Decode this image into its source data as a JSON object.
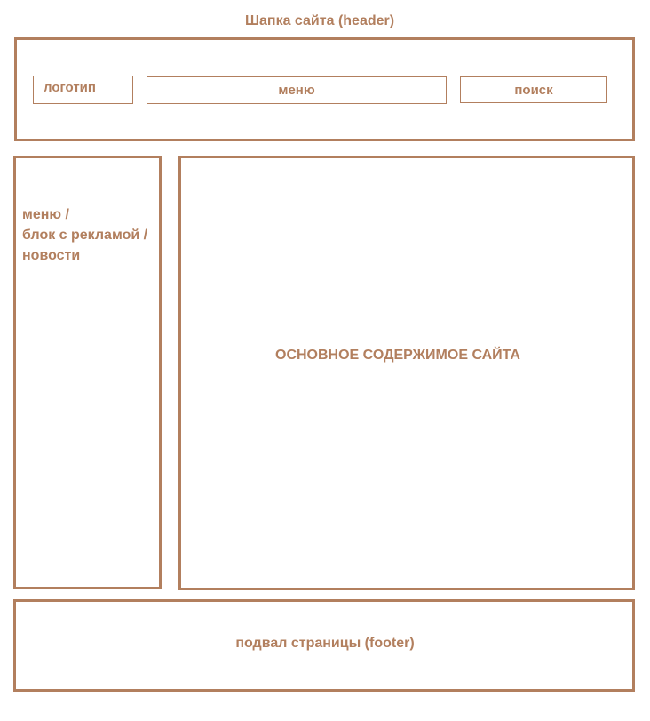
{
  "header": {
    "title": "Шапка сайта (header)",
    "logo_label": "логотип",
    "menu_label": "меню",
    "search_label": "поиск"
  },
  "sidebar": {
    "lines": [
      "меню /",
      "блок с рекламой /",
      "новости"
    ]
  },
  "main": {
    "label": "ОСНОВНОЕ СОДЕРЖИМОЕ САЙТА"
  },
  "footer": {
    "label": "подвал страницы (footer)"
  },
  "colors": {
    "stroke": "#b27f5e",
    "text": "#b27f5e",
    "background": "#ffffff"
  }
}
